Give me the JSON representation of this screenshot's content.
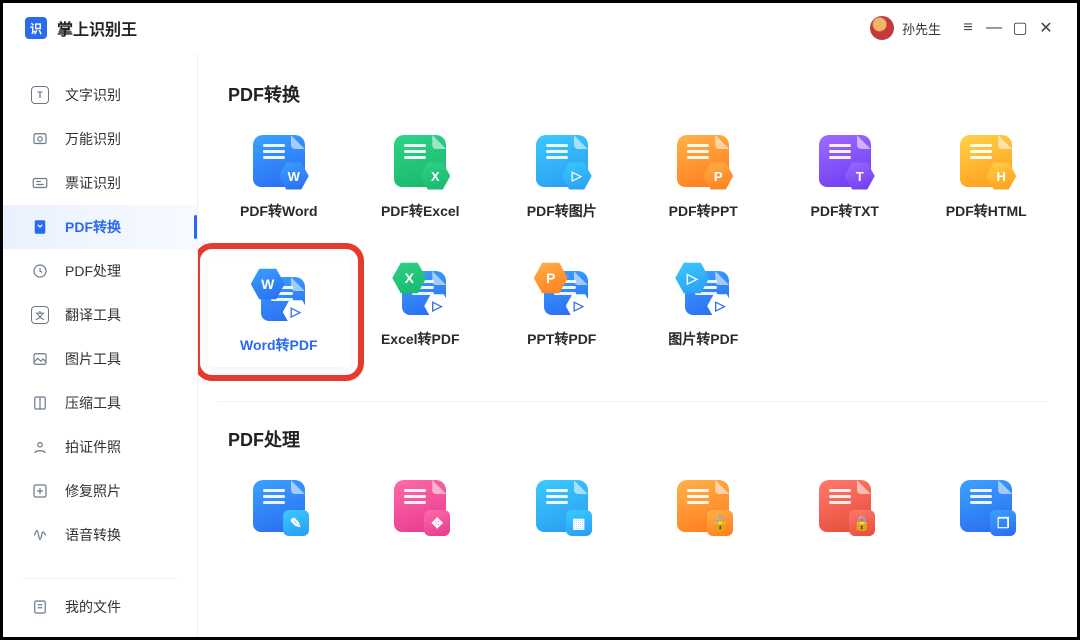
{
  "app": {
    "title": "掌上识别王"
  },
  "user": {
    "name": "孙先生"
  },
  "sidebar": {
    "items": [
      {
        "label": "文字识别"
      },
      {
        "label": "万能识别"
      },
      {
        "label": "票证识别"
      },
      {
        "label": "PDF转换"
      },
      {
        "label": "PDF处理"
      },
      {
        "label": "翻译工具"
      },
      {
        "label": "图片工具"
      },
      {
        "label": "压缩工具"
      },
      {
        "label": "拍证件照"
      },
      {
        "label": "修复照片"
      },
      {
        "label": "语音转换"
      }
    ],
    "footer": {
      "label": "我的文件"
    }
  },
  "sections": {
    "convert": {
      "title": "PDF转换",
      "row1": [
        {
          "label": "PDF转Word",
          "doc": "c-blue",
          "badge": "W",
          "badge_bg": "c-blue"
        },
        {
          "label": "PDF转Excel",
          "doc": "c-green",
          "badge": "X",
          "badge_bg": "c-green"
        },
        {
          "label": "PDF转图片",
          "doc": "c-cyan",
          "badge": "▷",
          "badge_bg": "c-cyan"
        },
        {
          "label": "PDF转PPT",
          "doc": "c-orange",
          "badge": "P",
          "badge_bg": "c-orange"
        },
        {
          "label": "PDF转TXT",
          "doc": "c-purple",
          "badge": "T",
          "badge_bg": "c-purple"
        },
        {
          "label": "PDF转HTML",
          "doc": "c-amber",
          "badge": "H",
          "badge_bg": "c-amber"
        }
      ],
      "row2": [
        {
          "label": "Word转PDF",
          "big": "W",
          "big_bg": "c-blue",
          "highlight": true
        },
        {
          "label": "Excel转PDF",
          "big": "X",
          "big_bg": "c-green"
        },
        {
          "label": "PPT转PDF",
          "big": "P",
          "big_bg": "c-orange"
        },
        {
          "label": "图片转PDF",
          "big": "▷",
          "big_bg": "c-cyan"
        }
      ]
    },
    "process": {
      "title": "PDF处理",
      "row": [
        {
          "doc": "c-blue",
          "sq": "✎",
          "sq_bg": "c-cyan"
        },
        {
          "doc": "c-pink",
          "sq": "✥",
          "sq_bg": "c-pink"
        },
        {
          "doc": "c-cyan",
          "sq": "▦",
          "sq_bg": "c-cyan"
        },
        {
          "doc": "c-orange",
          "sq": "🔓",
          "sq_bg": "c-orange"
        },
        {
          "doc": "c-red",
          "sq": "🔒",
          "sq_bg": "c-red"
        },
        {
          "doc": "c-blue",
          "sq": "❐",
          "sq_bg": "c-blue"
        }
      ]
    }
  }
}
